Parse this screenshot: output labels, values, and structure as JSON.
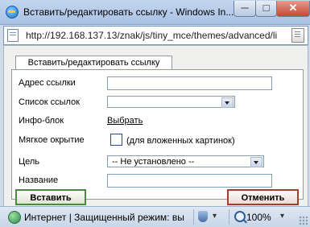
{
  "window": {
    "title": "Вставить/редактировать ссылку - Windows In...",
    "minimize": "─",
    "maximize": "□",
    "close": "✕"
  },
  "address_bar": {
    "url": "http://192.168.137.13/znak/js/tiny_mce/themes/advanced/li"
  },
  "dialog": {
    "tab_label": "Вставить/редактировать ссылку",
    "fields": {
      "url_label": "Адрес ссылки",
      "url_value": "",
      "list_label": "Список ссылок",
      "list_value": "",
      "infoblock_label": "Инфо-блок",
      "infoblock_link": "Выбрать",
      "soft_open_label": "Мягкое окрытие",
      "soft_open_hint": "(для вложенных картинок)",
      "soft_open_checked": false,
      "target_label": "Цель",
      "target_value": "-- Не установлено --",
      "title_label": "Название",
      "title_value": ""
    },
    "insert_button": "Вставить",
    "cancel_button": "Отменить"
  },
  "status_bar": {
    "zone_text": "Интернет | Защищенный режим: вы",
    "zoom": "100%",
    "dropdown_glyph": "▾"
  }
}
